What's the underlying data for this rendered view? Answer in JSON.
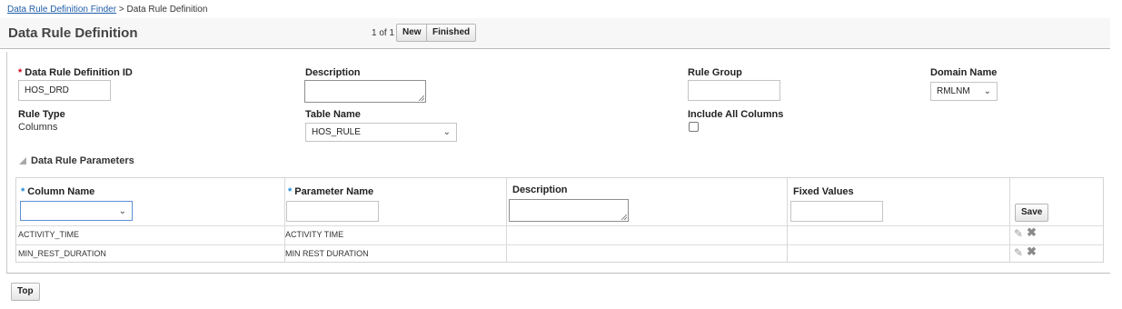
{
  "breadcrumb": {
    "link": "Data Rule Definition Finder",
    "separator": ">",
    "current": "Data Rule Definition"
  },
  "header": {
    "title": "Data Rule Definition",
    "pager": "1 of 1",
    "new_label": "New",
    "finished_label": "Finished"
  },
  "form": {
    "required_marker": "*",
    "id_label": "Data Rule Definition ID",
    "id_value": "HOS_DRD",
    "description_label": "Description",
    "description_value": "",
    "rule_group_label": "Rule Group",
    "rule_group_value": "",
    "domain_label": "Domain Name",
    "domain_value": "RMLNM",
    "rule_type_label": "Rule Type",
    "rule_type_value": "Columns",
    "table_label": "Table Name",
    "table_value": "HOS_RULE",
    "include_cols_label": "Include All Columns",
    "include_cols_checked": false
  },
  "parameters": {
    "section_title": "Data Rule Parameters",
    "columns": {
      "column_name": "Column Name",
      "parameter_name": "Parameter Name",
      "description": "Description",
      "fixed_values": "Fixed Values"
    },
    "save_label": "Save",
    "rows": [
      {
        "column": "ACTIVITY_TIME",
        "parameter": "ACTIVITY TIME",
        "description": "",
        "fixed": ""
      },
      {
        "column": "MIN_REST_DURATION",
        "parameter": "MIN REST DURATION",
        "description": "",
        "fixed": ""
      }
    ]
  },
  "footer": {
    "top_label": "Top"
  },
  "icons": {
    "chevron": "chevron-down-icon",
    "edit": "pencil-icon",
    "delete": "x-icon"
  }
}
